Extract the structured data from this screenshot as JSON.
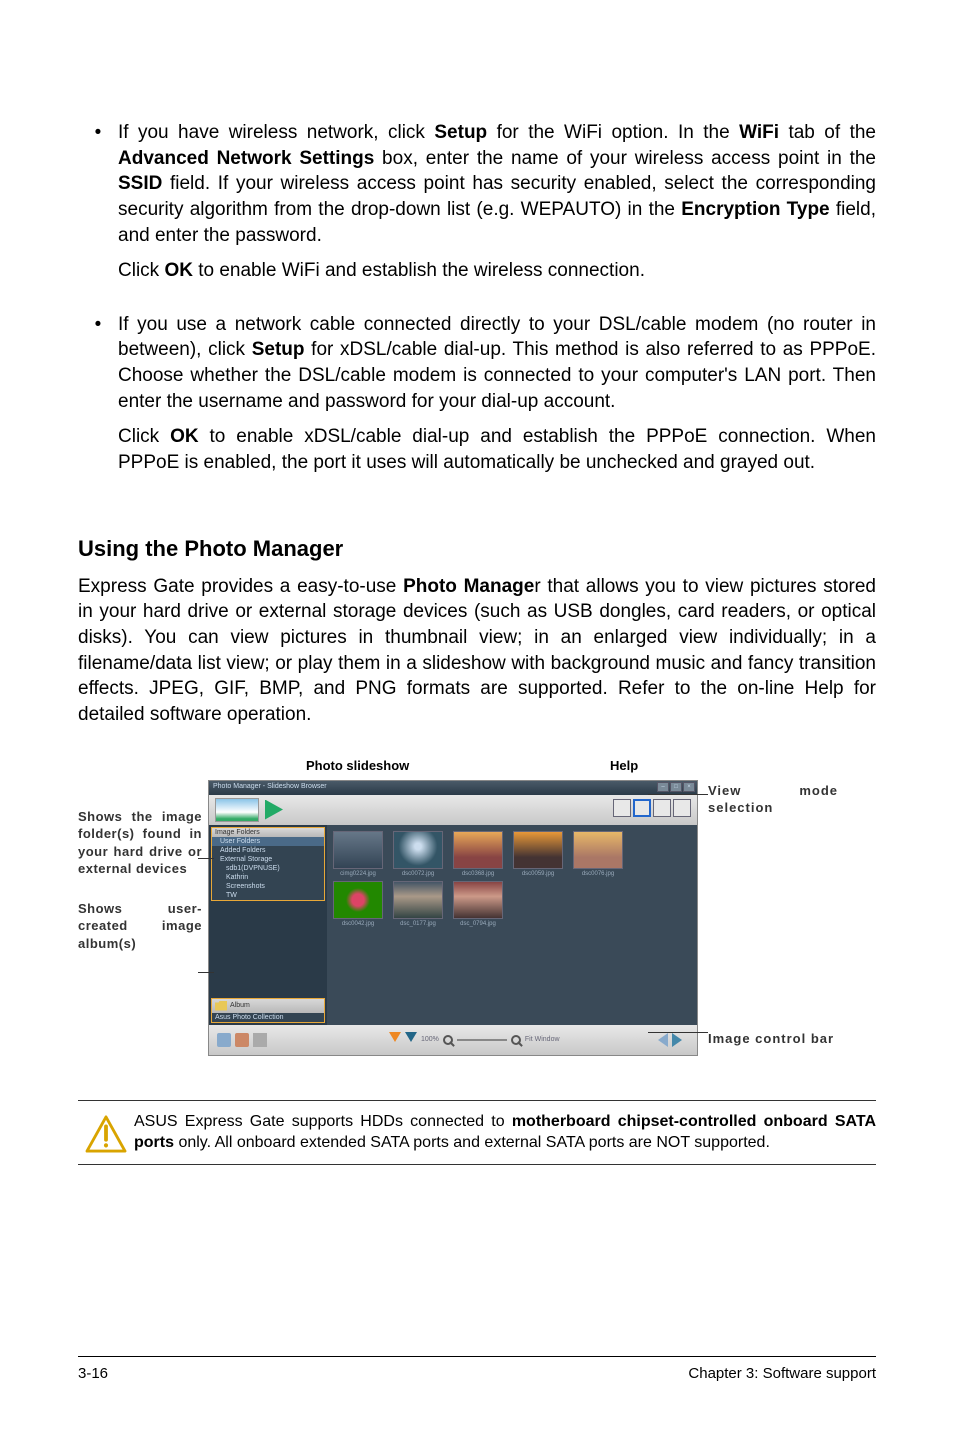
{
  "bullets": [
    {
      "para1_parts": [
        "If you have wireless network, click ",
        {
          "b": "Setup"
        },
        " for the WiFi option. In the ",
        {
          "b": "WiFi"
        },
        " tab of the ",
        {
          "b": "Advanced Network Settings"
        },
        " box, enter the name of your wireless access point in the ",
        {
          "b": "SSID"
        },
        " field. If your wireless access point has security enabled, select the corresponding security algorithm from the drop-down list (e.g. WEPAUTO) in the ",
        {
          "b": "Encryption Type"
        },
        " field, and enter the password."
      ],
      "para2_parts": [
        "Click ",
        {
          "b": "OK"
        },
        " to enable WiFi and establish the wireless connection."
      ]
    },
    {
      "para1_parts": [
        "If you use a network cable connected directly to your DSL/cable modem (no router in between), click ",
        {
          "b": "Setup"
        },
        " for xDSL/cable dial-up. This method is also referred to as PPPoE. Choose whether the DSL/cable modem is connected to your computer's LAN port. Then enter the username and password for your dial-up account."
      ],
      "para2_parts": [
        "Click ",
        {
          "b": "OK"
        },
        " to enable xDSL/cable dial-up and establish the PPPoE connection. When PPPoE is enabled, the port it uses will automatically be unchecked and grayed out."
      ]
    }
  ],
  "section_heading": "Using the Photo Manager",
  "section_body_parts": [
    "Express Gate  provides a easy-to-use ",
    {
      "b": "Photo Manage"
    },
    "r that allows you to view pictures stored in your hard drive or external storage devices (such as USB dongles, card readers, or optical disks). You can view pictures in thumbnail view; in an enlarged view individually; in a filename/data list view; or play them in a slideshow with background music and fancy transition effects. JPEG, GIF, BMP, and PNG formats are supported. Refer to the on-line Help for detailed software operation."
  ],
  "diagram": {
    "top_labels": {
      "slideshow": "Photo slideshow",
      "help": "Help"
    },
    "left": {
      "d1": "Shows the image folder(s) found in your hard drive or external devices",
      "d2": "Shows user-created image album(s)"
    },
    "right": {
      "r1": "View mode selection",
      "r2": "Image control bar"
    },
    "window": {
      "title": "Photo Manager - Slideshow Browser",
      "sidebar": {
        "header1": "Image Folders",
        "item_user": "User Folders",
        "item_added": "Added Folders",
        "item_ext": "External Storage",
        "item_sdb": "sdb1(DVPNUSE)",
        "item_kathrin": "Kathrin",
        "item_scr": "Screenshots",
        "item_tw": "TW",
        "album_label": "Album",
        "album_item": "Asus Photo Collection"
      },
      "thumbs": {
        "row1": [
          "cimg0224.jpg",
          "dsc0072.jpg",
          "dsc0368.jpg",
          "dsc0059.jpg",
          "dsc0076.jpg"
        ],
        "row2": [
          "dsc0042.jpg",
          "dsc_0177.jpg",
          "dsc_0794.jpg"
        ]
      },
      "bottombar": {
        "pct": "100%",
        "fit": "Fit Window"
      }
    }
  },
  "note_parts": [
    "ASUS Express Gate supports HDDs connected to ",
    {
      "b": "motherboard chipset-controlled onboard SATA ports"
    },
    " only. All onboard extended SATA ports and external SATA ports are NOT supported."
  ],
  "footer": {
    "left": "3-16",
    "right": "Chapter 3: Software support"
  }
}
